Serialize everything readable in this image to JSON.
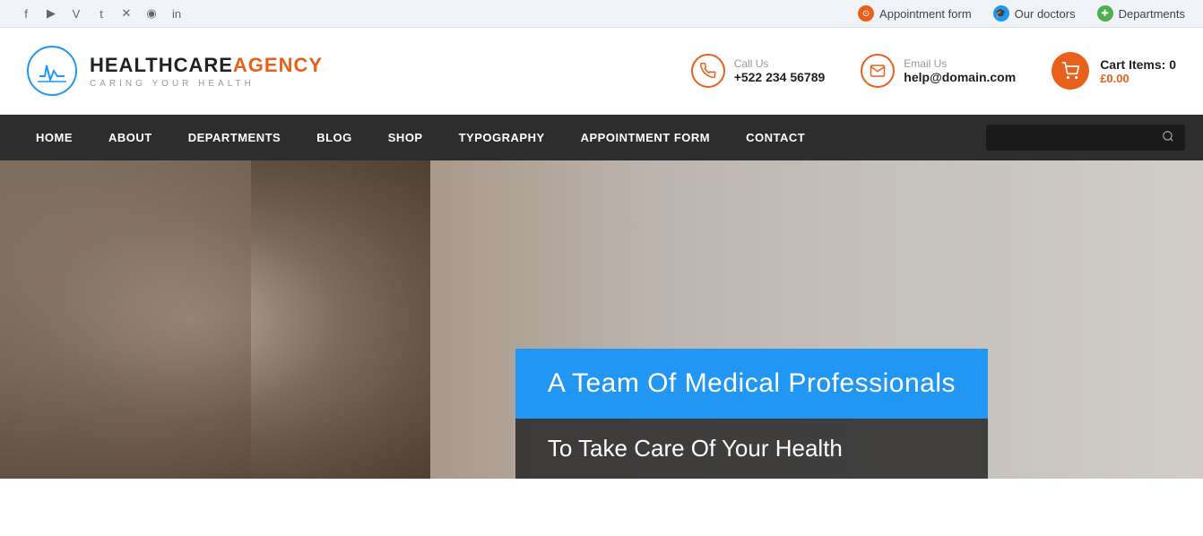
{
  "top_bar": {
    "social_icons": [
      "f",
      "▶",
      "V",
      "t",
      "x",
      "◉",
      "in"
    ],
    "nav_items": [
      {
        "label": "Appointment form",
        "icon": "⊙",
        "icon_color": "orange"
      },
      {
        "label": "Our doctors",
        "icon": "🎓",
        "icon_color": "blue"
      },
      {
        "label": "Departments",
        "icon": "✚",
        "icon_color": "green"
      }
    ]
  },
  "header": {
    "logo": {
      "name_black": "HEALTHCARE",
      "name_orange": "AGENCY",
      "tagline": "CARING YOUR HEALTH"
    },
    "call": {
      "label": "Call Us",
      "value": "+522 234 56789"
    },
    "email": {
      "label": "Email Us",
      "value": "help@domain.com"
    },
    "cart": {
      "label": "Cart Items: 0",
      "price": "£0.00"
    }
  },
  "nav": {
    "items": [
      {
        "label": "HOME"
      },
      {
        "label": "ABOUT"
      },
      {
        "label": "DEPARTMENTS"
      },
      {
        "label": "BLOG"
      },
      {
        "label": "SHOP"
      },
      {
        "label": "TYPOGRAPHY"
      },
      {
        "label": "APPOINTMENT FORM"
      },
      {
        "label": "CONTACT"
      }
    ],
    "search_placeholder": ""
  },
  "hero": {
    "title": "A Team Of Medical Professionals",
    "subtitle": "To Take Care Of Your Health"
  }
}
